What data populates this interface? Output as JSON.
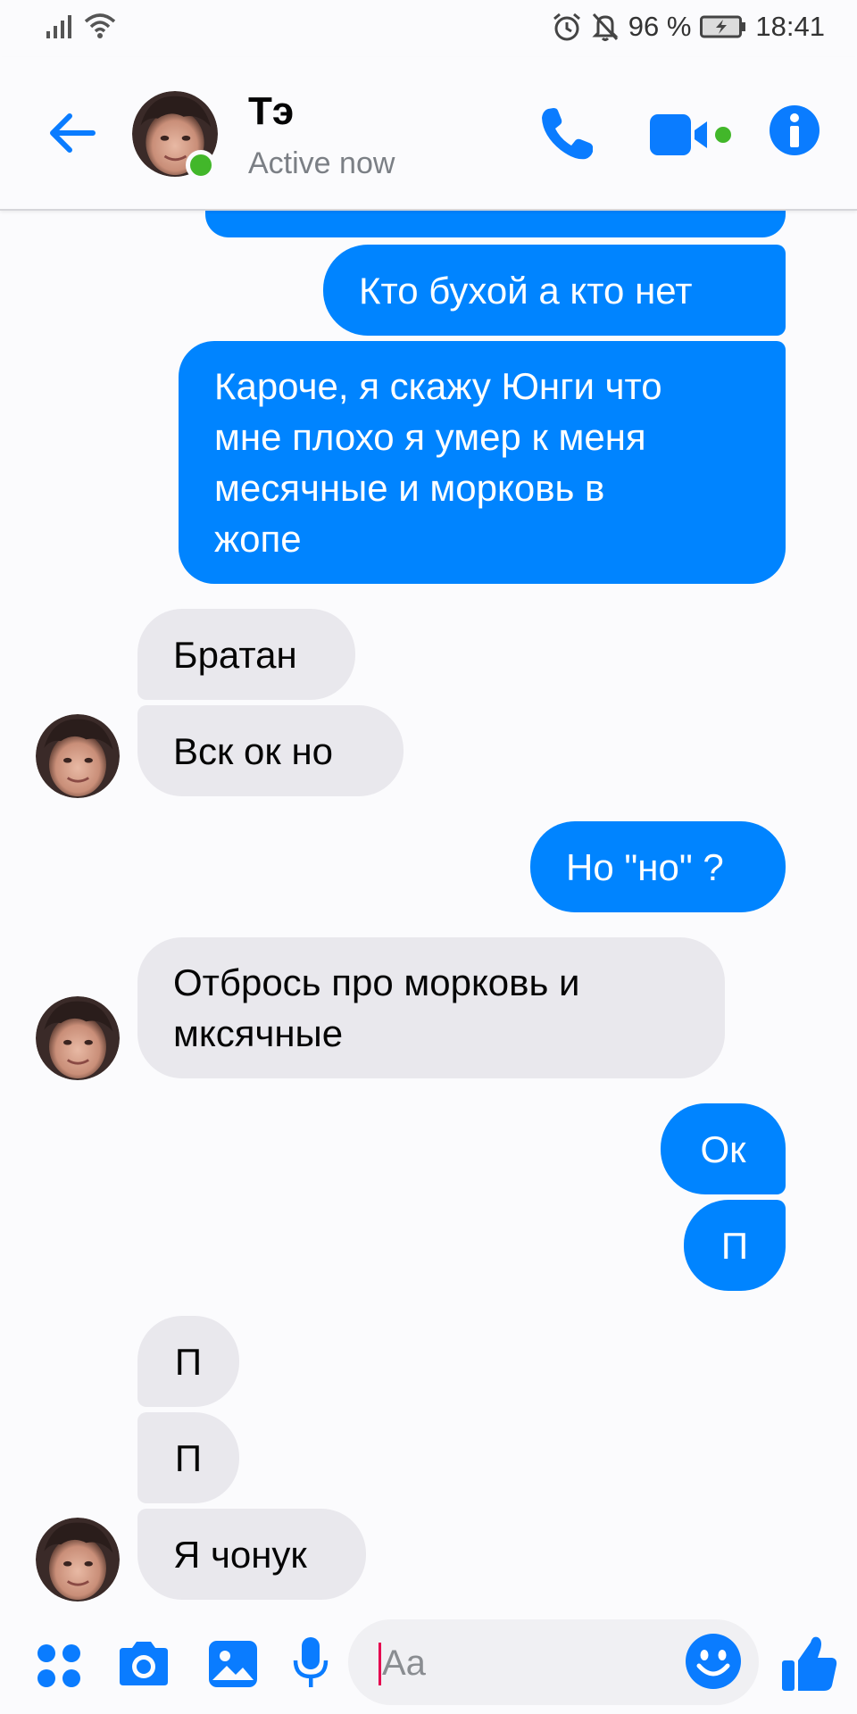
{
  "status_bar": {
    "battery_percent": "96 %",
    "time": "18:41"
  },
  "header": {
    "contact_name": "Тэ",
    "contact_status": "Active now"
  },
  "messages": [
    {
      "direction": "outgoing",
      "text": ""
    },
    {
      "direction": "outgoing",
      "text": "Кто бухой а кто нет"
    },
    {
      "direction": "outgoing",
      "lines": [
        "Кароче, я скажу Юнги что",
        "мне плохо я умер к меня",
        "месячные и морковь в",
        "жопе"
      ]
    },
    {
      "direction": "incoming",
      "text": "Братан"
    },
    {
      "direction": "incoming",
      "text": "Вск ок но"
    },
    {
      "direction": "outgoing",
      "text": "Но \"но\" ?"
    },
    {
      "direction": "incoming",
      "lines": [
        "Отбрось про морковь и",
        "мксячные"
      ]
    },
    {
      "direction": "outgoing",
      "text": "Ок"
    },
    {
      "direction": "outgoing",
      "text": "П"
    },
    {
      "direction": "incoming",
      "text": "П"
    },
    {
      "direction": "incoming",
      "text": "П"
    },
    {
      "direction": "incoming",
      "text": "Я чонук"
    }
  ],
  "composer": {
    "placeholder": "Aa"
  },
  "colors": {
    "accent": "#0084ff",
    "incoming_bubble": "#e9e8ed",
    "online": "#42b72a"
  },
  "icons": [
    "signal-icon",
    "wifi-icon",
    "alarm-icon",
    "mute-icon",
    "battery-icon",
    "back-arrow-icon",
    "phone-icon",
    "video-icon",
    "info-icon",
    "apps-icon",
    "camera-icon",
    "gallery-icon",
    "microphone-icon",
    "emoji-icon",
    "thumbs-up-icon"
  ]
}
